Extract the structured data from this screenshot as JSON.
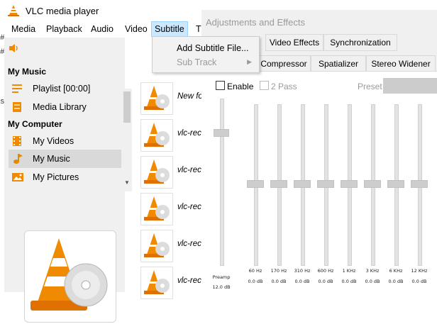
{
  "colors": {
    "menu_active_bg": "#cce8ff",
    "sidebar_bg": "#f0f0f0",
    "selected_item_bg": "#d9d9d9",
    "disabled_text": "#9a9a9a",
    "vlc_orange": "#f08a00"
  },
  "vlc": {
    "title": "VLC media player",
    "menu": [
      "Media",
      "Playback",
      "Audio",
      "Video",
      "Subtitle",
      "T"
    ],
    "active_menu": "Subtitle"
  },
  "sidebar": {
    "volume_icon": "speaker-icon",
    "sections": [
      "My Music",
      "My Computer"
    ],
    "items": [
      {
        "label": "Playlist [00:00]",
        "icon": "playlist-icon"
      },
      {
        "label": "Media Library",
        "icon": "media-library-icon"
      },
      {
        "label": "My Videos",
        "icon": "film-icon"
      },
      {
        "label": "My Music",
        "icon": "music-note-icon",
        "selected": true
      },
      {
        "label": "My Pictures",
        "icon": "picture-icon"
      }
    ]
  },
  "playlist": {
    "items": [
      "New fo",
      "vlc-rec",
      "vlc-rec",
      "vlc-rec",
      "vlc-rec",
      "vlc-rec"
    ]
  },
  "subtitle_menu": {
    "items": [
      {
        "label": "Add Subtitle File...",
        "enabled": true
      },
      {
        "label": "Sub Track",
        "enabled": false
      }
    ]
  },
  "adjustments": {
    "title": "Adjustments and Effects",
    "tabs_row1": [
      "Video Effects",
      "Synchronization"
    ],
    "tabs_row2": [
      "Compressor",
      "Spatializer",
      "Stereo Widener"
    ],
    "enable_label": "Enable",
    "twopass_label": "2 Pass",
    "preset_label": "Preset",
    "preamp": {
      "label": "Preamp",
      "value": "12.0 dB"
    },
    "bands": [
      {
        "freq": "60 Hz",
        "value": "0.0 dB"
      },
      {
        "freq": "170 Hz",
        "value": "0.0 dB"
      },
      {
        "freq": "310 Hz",
        "value": "0.0 dB"
      },
      {
        "freq": "600 Hz",
        "value": "0.0 dB"
      },
      {
        "freq": "1 KHz",
        "value": "0.0 dB"
      },
      {
        "freq": "3 KHz",
        "value": "0.0 dB"
      },
      {
        "freq": "6 KHz",
        "value": "0.0 dB"
      },
      {
        "freq": "12 KHz",
        "value": "0.0 dB"
      }
    ]
  }
}
